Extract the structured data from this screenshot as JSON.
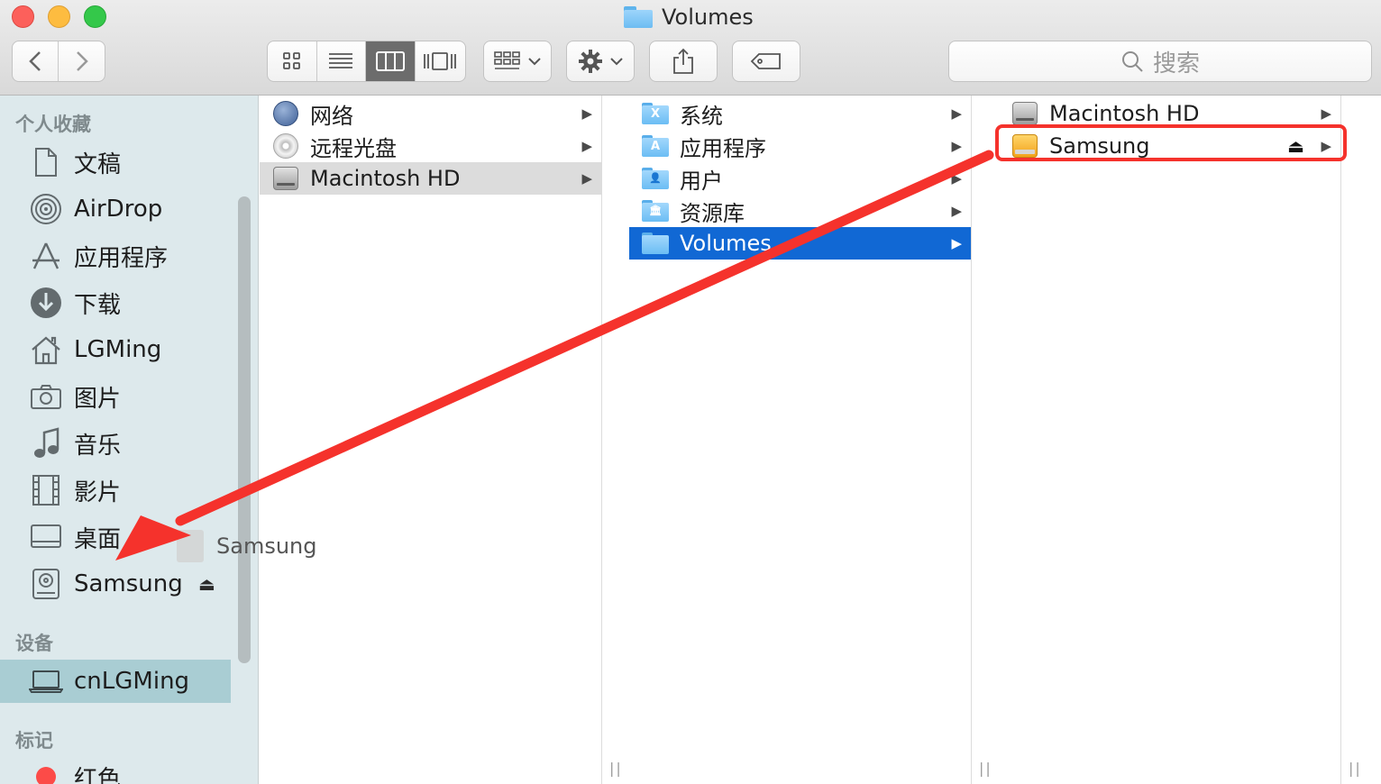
{
  "window": {
    "title": "Volumes"
  },
  "toolbar": {
    "back_icon": "chevron-left-icon",
    "forward_icon": "chevron-right-icon",
    "view_modes": [
      "icon-view",
      "list-view",
      "column-view",
      "cover-flow-view"
    ],
    "active_view": "column-view",
    "search_placeholder": "搜索"
  },
  "sidebar": {
    "favorites_header": "个人收藏",
    "favorites": [
      {
        "label": "文稿",
        "icon": "document-icon"
      },
      {
        "label": "AirDrop",
        "icon": "airdrop-icon"
      },
      {
        "label": "应用程序",
        "icon": "applications-icon"
      },
      {
        "label": "下载",
        "icon": "download-icon"
      },
      {
        "label": "LGMing",
        "icon": "home-icon"
      },
      {
        "label": "图片",
        "icon": "camera-icon"
      },
      {
        "label": "音乐",
        "icon": "music-note-icon"
      },
      {
        "label": "影片",
        "icon": "film-icon"
      },
      {
        "label": "桌面",
        "icon": "desktop-icon"
      },
      {
        "label": "Samsung",
        "icon": "drive-icon",
        "eject": "⏏"
      }
    ],
    "devices_header": "设备",
    "devices": [
      {
        "label": "cnLGMing",
        "icon": "laptop-icon",
        "selected": true
      }
    ],
    "tags_header": "标记",
    "tags": [
      {
        "label": "红色",
        "color": "#fc4b48"
      }
    ]
  },
  "columns": {
    "col1": [
      {
        "label": "网络",
        "icon": "network-globe-icon"
      },
      {
        "label": "远程光盘",
        "icon": "disc-icon"
      },
      {
        "label": "Macintosh HD",
        "icon": "hard-drive-icon",
        "state": "parent-selected"
      }
    ],
    "col2": [
      {
        "label": "系统",
        "icon": "system-folder-icon",
        "glyph": "X"
      },
      {
        "label": "应用程序",
        "icon": "applications-folder-icon",
        "glyph": "A"
      },
      {
        "label": "用户",
        "icon": "users-folder-icon",
        "glyph": "👤"
      },
      {
        "label": "资源库",
        "icon": "library-folder-icon",
        "glyph": "🏛"
      },
      {
        "label": "Volumes",
        "icon": "folder-icon",
        "glyph": "",
        "state": "selected"
      }
    ],
    "col3": [
      {
        "label": "Macintosh HD",
        "icon": "hard-drive-icon"
      },
      {
        "label": "Samsung",
        "icon": "external-drive-icon",
        "eject": "⏏",
        "highlighted": true
      }
    ]
  },
  "drag_ghost": {
    "label": "Samsung"
  },
  "annotation": {
    "color": "#f5322c"
  }
}
